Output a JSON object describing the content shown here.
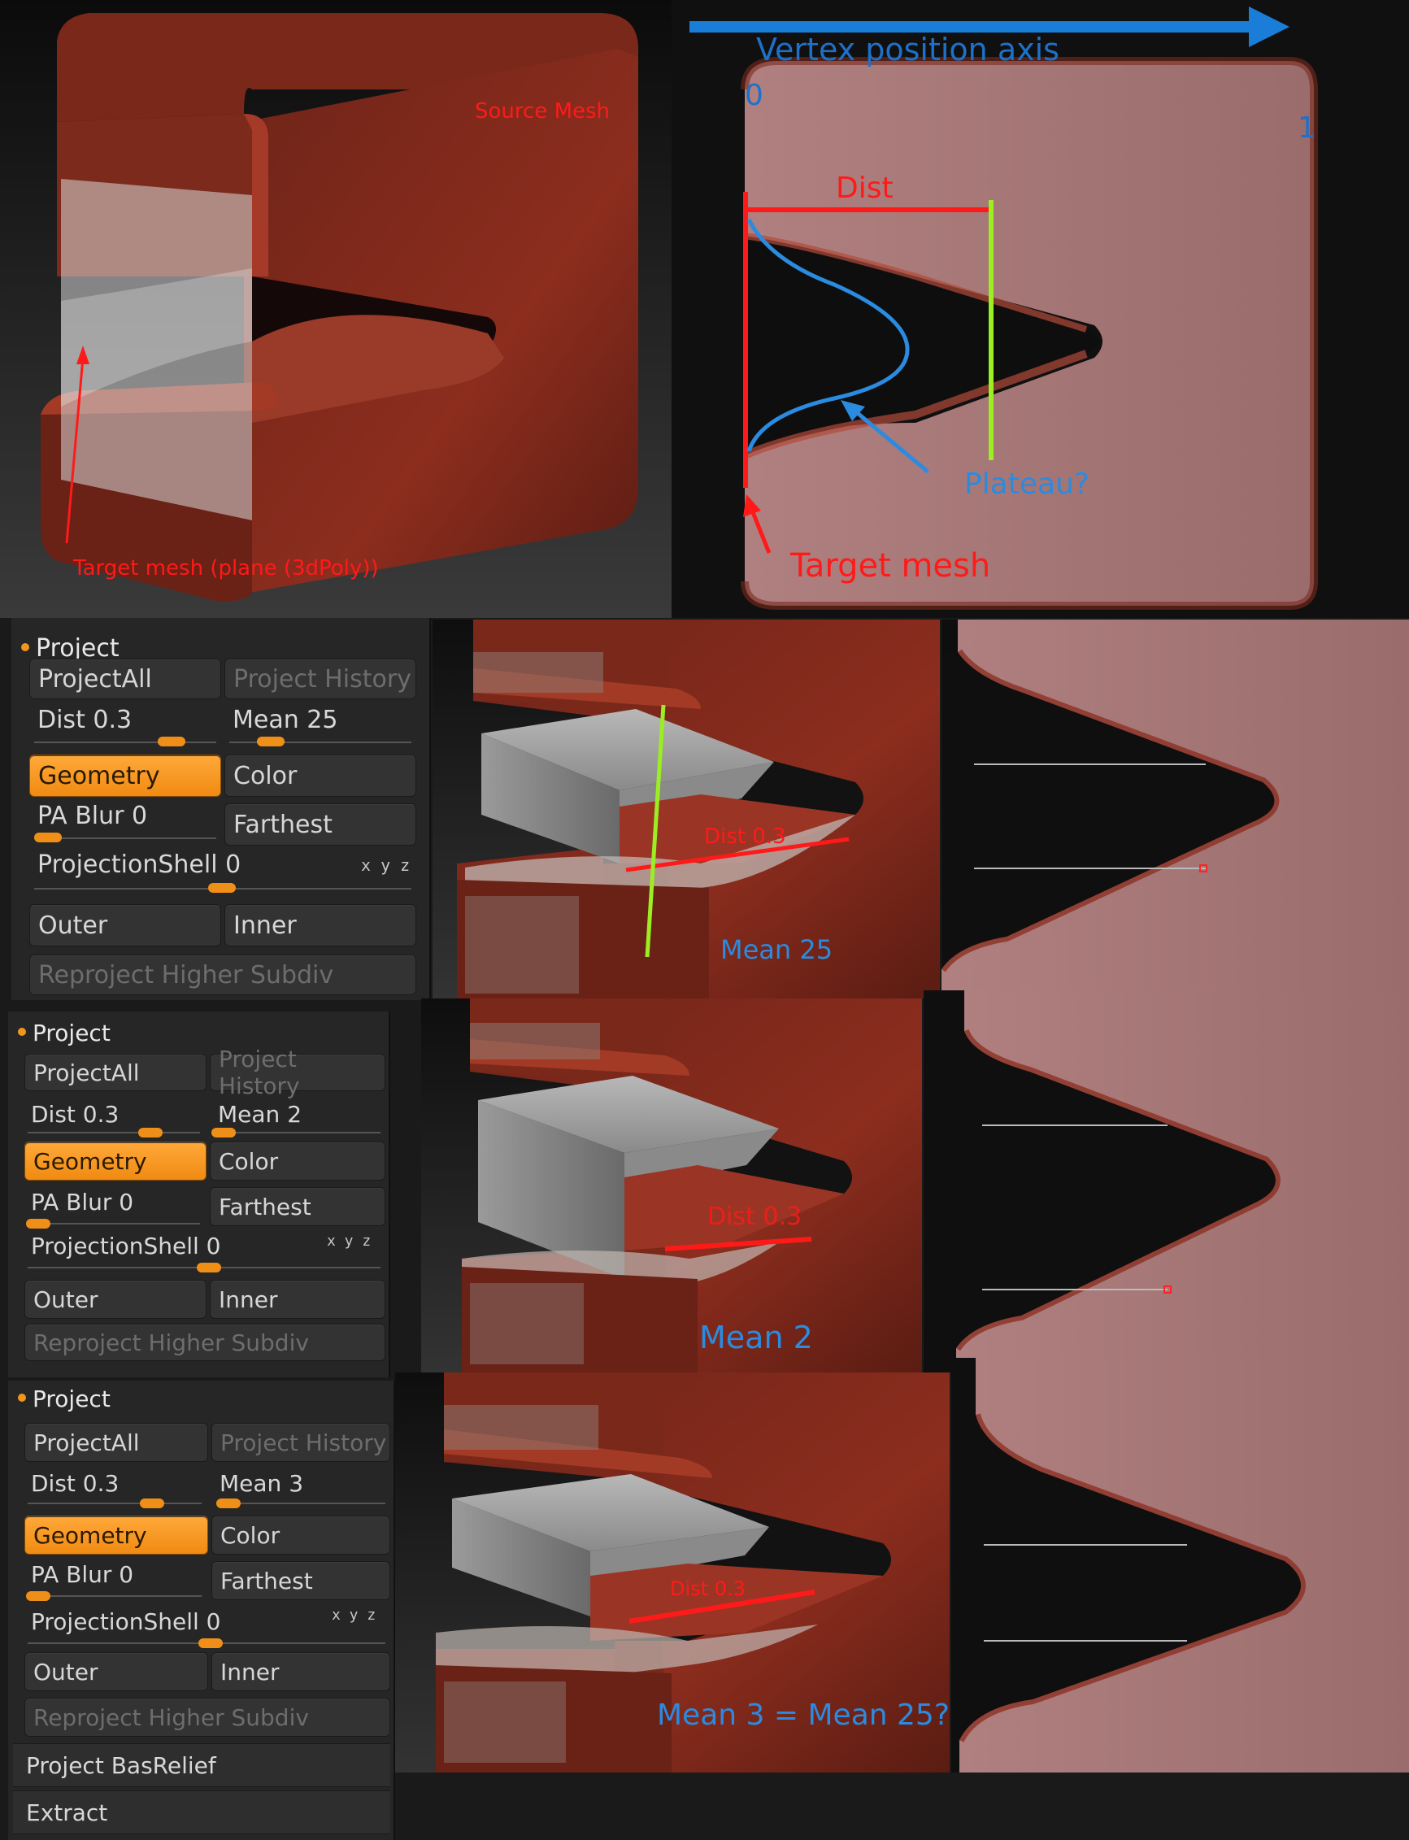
{
  "top_left": {
    "source_label": "Source Mesh",
    "target_label": "Target mesh (plane (3dPoly))"
  },
  "top_right": {
    "axis_label": "Vertex position axis",
    "axis_start": "0",
    "axis_end": "1",
    "dist_label": "Dist",
    "plateau_label": "Plateau?",
    "target_label": "Target mesh"
  },
  "panels": [
    {
      "title": "Project",
      "project_all": "ProjectAll",
      "project_history": "Project History",
      "dist": "Dist 0.3",
      "mean": "Mean 25",
      "geometry": "Geometry",
      "color": "Color",
      "pa_blur": "PA Blur 0",
      "farthest": "Farthest",
      "projection_shell": "ProjectionShell 0",
      "xyz": "x y z",
      "outer": "Outer",
      "inner": "Inner",
      "reproject": "Reproject Higher Subdiv"
    },
    {
      "title": "Project",
      "project_all": "ProjectAll",
      "project_history": "Project History",
      "dist": "Dist 0.3",
      "mean": "Mean 2",
      "geometry": "Geometry",
      "color": "Color",
      "pa_blur": "PA Blur 0",
      "farthest": "Farthest",
      "projection_shell": "ProjectionShell 0",
      "xyz": "x y z",
      "outer": "Outer",
      "inner": "Inner",
      "reproject": "Reproject Higher Subdiv"
    },
    {
      "title": "Project",
      "project_all": "ProjectAll",
      "project_history": "Project History",
      "dist": "Dist 0.3",
      "mean": "Mean 3",
      "geometry": "Geometry",
      "color": "Color",
      "pa_blur": "PA Blur 0",
      "farthest": "Farthest",
      "projection_shell": "ProjectionShell 0",
      "xyz": "x y z",
      "outer": "Outer",
      "inner": "Inner",
      "reproject": "Reproject Higher Subdiv",
      "bas_relief": "Project BasRelief",
      "extract": "Extract"
    }
  ],
  "row_annotations": [
    {
      "dist": "Dist 0.3",
      "mean": "Mean 25"
    },
    {
      "dist": "Dist 0.3",
      "mean": "Mean 2"
    },
    {
      "dist": "Dist 0.3",
      "mean": "Mean 3 = Mean 25?"
    }
  ],
  "colors": {
    "orange": "#f08f18",
    "mesh_red": "#8c2b1c",
    "mesh_pink": "#a87878",
    "annotation_red": "#ff1a1a",
    "annotation_blue": "#2a8be0",
    "annotation_green": "#9aee22"
  }
}
